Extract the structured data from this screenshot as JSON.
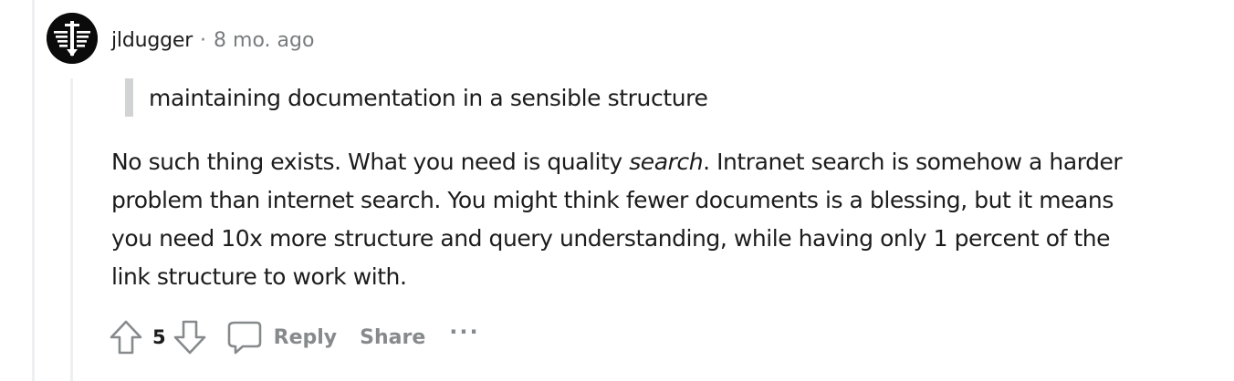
{
  "comment": {
    "author": "jldugger",
    "separator": "·",
    "timestamp": "8 mo. ago",
    "quote": "maintaining documentation in a sensible structure",
    "body": {
      "line1_before": "No such thing exists. What you need is quality ",
      "line1_em": "search",
      "line1_after": ". Intranet search is somehow a harder",
      "line2": "problem than internet search. You might think fewer documents is a blessing, but it means",
      "line3": "you need 10x more structure and query understanding, while having only 1 percent of the",
      "line4": "link structure to work with."
    },
    "actions": {
      "upvote_icon": "arrow-up-outline-icon",
      "vote_count": "5",
      "downvote_icon": "arrow-down-outline-icon",
      "reply_icon": "speech-bubble-icon",
      "reply_label": "Reply",
      "share_label": "Share",
      "more_label": "···"
    }
  },
  "colors": {
    "meta_gray": "#787c7e",
    "action_gray": "#878a8c",
    "quote_bar": "#d1d3d5",
    "thread_line": "#edeff1",
    "text": "#1c1c1c",
    "avatar_bg": "#0b0b0b"
  }
}
